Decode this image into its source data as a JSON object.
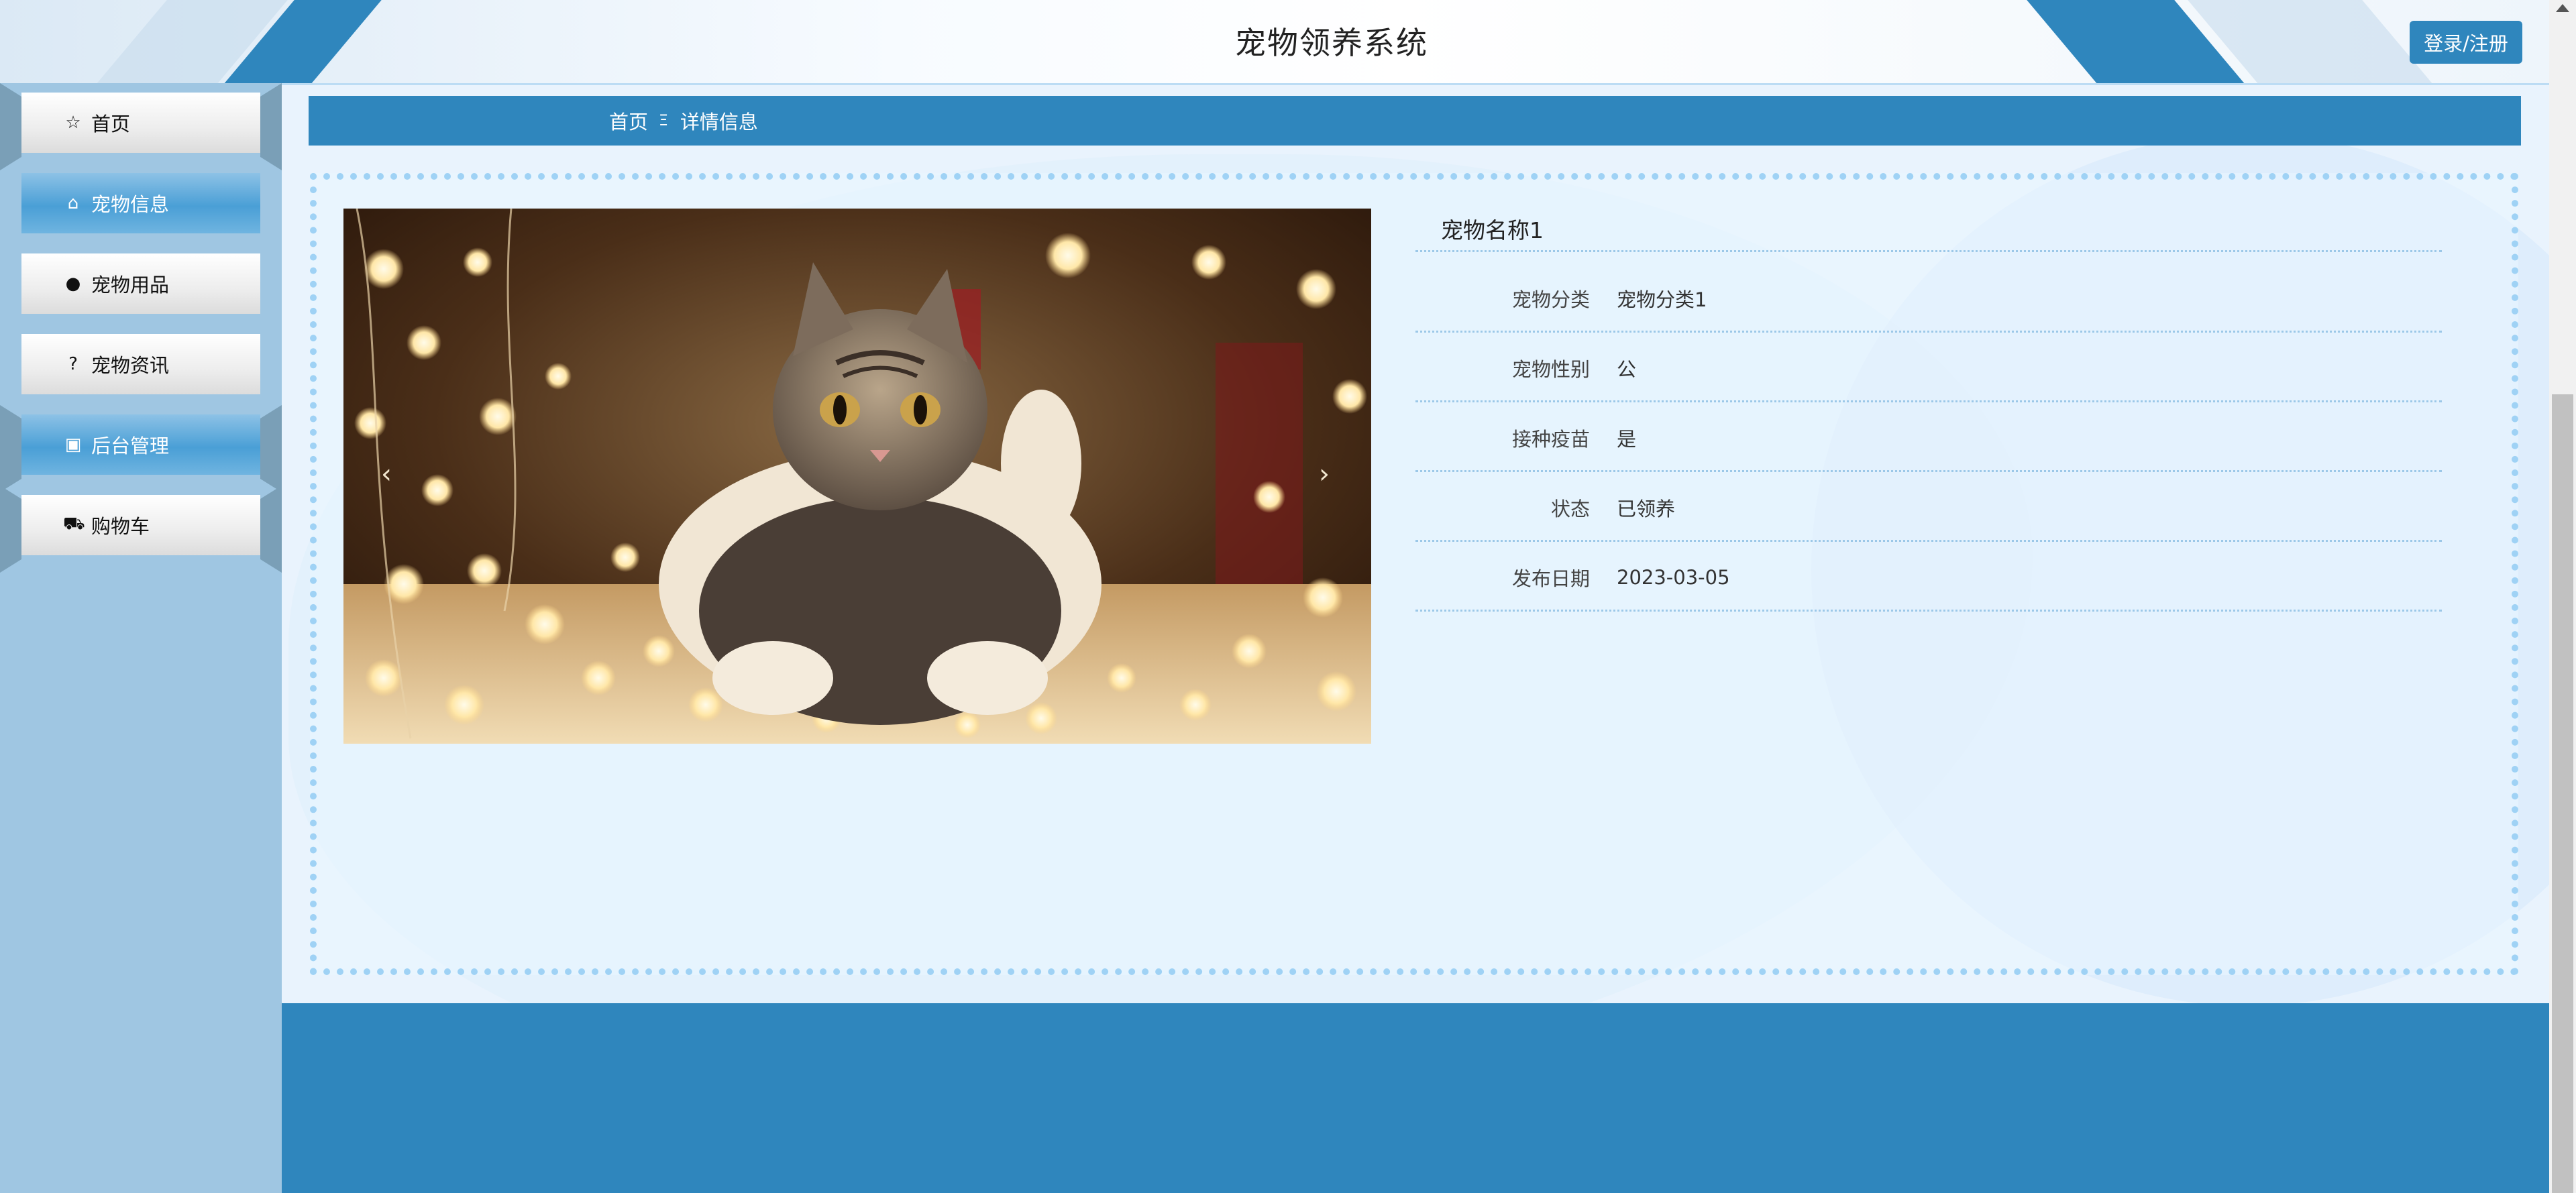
{
  "header": {
    "title": "宠物领养系统",
    "login_label": "登录/注册"
  },
  "sidebar": {
    "items": [
      {
        "label": "首页",
        "icon": "☆",
        "active": false
      },
      {
        "label": "宠物信息",
        "icon": "⌂",
        "active": true
      },
      {
        "label": "宠物用品",
        "icon": "●",
        "active": false
      },
      {
        "label": "宠物资讯",
        "icon": "?",
        "active": false
      },
      {
        "label": "后台管理",
        "icon": "▣",
        "active": true
      },
      {
        "label": "购物车",
        "icon": "⛟",
        "active": false
      }
    ]
  },
  "breadcrumb": {
    "home": "首页",
    "separator": "Ξ",
    "current": "详情信息"
  },
  "carousel": {
    "prev": "‹",
    "next": "›"
  },
  "detail": {
    "name": "宠物名称1",
    "fields": [
      {
        "label": "宠物分类",
        "value": "宠物分类1"
      },
      {
        "label": "宠物性别",
        "value": "公"
      },
      {
        "label": "接种疫苗",
        "value": "是"
      },
      {
        "label": "状态",
        "value": "已领养"
      },
      {
        "label": "发布日期",
        "value": "2023-03-05"
      }
    ]
  },
  "colors": {
    "primary": "#2f86bd",
    "sidebar": "#9fc6e2",
    "border": "#9fd2f5"
  }
}
